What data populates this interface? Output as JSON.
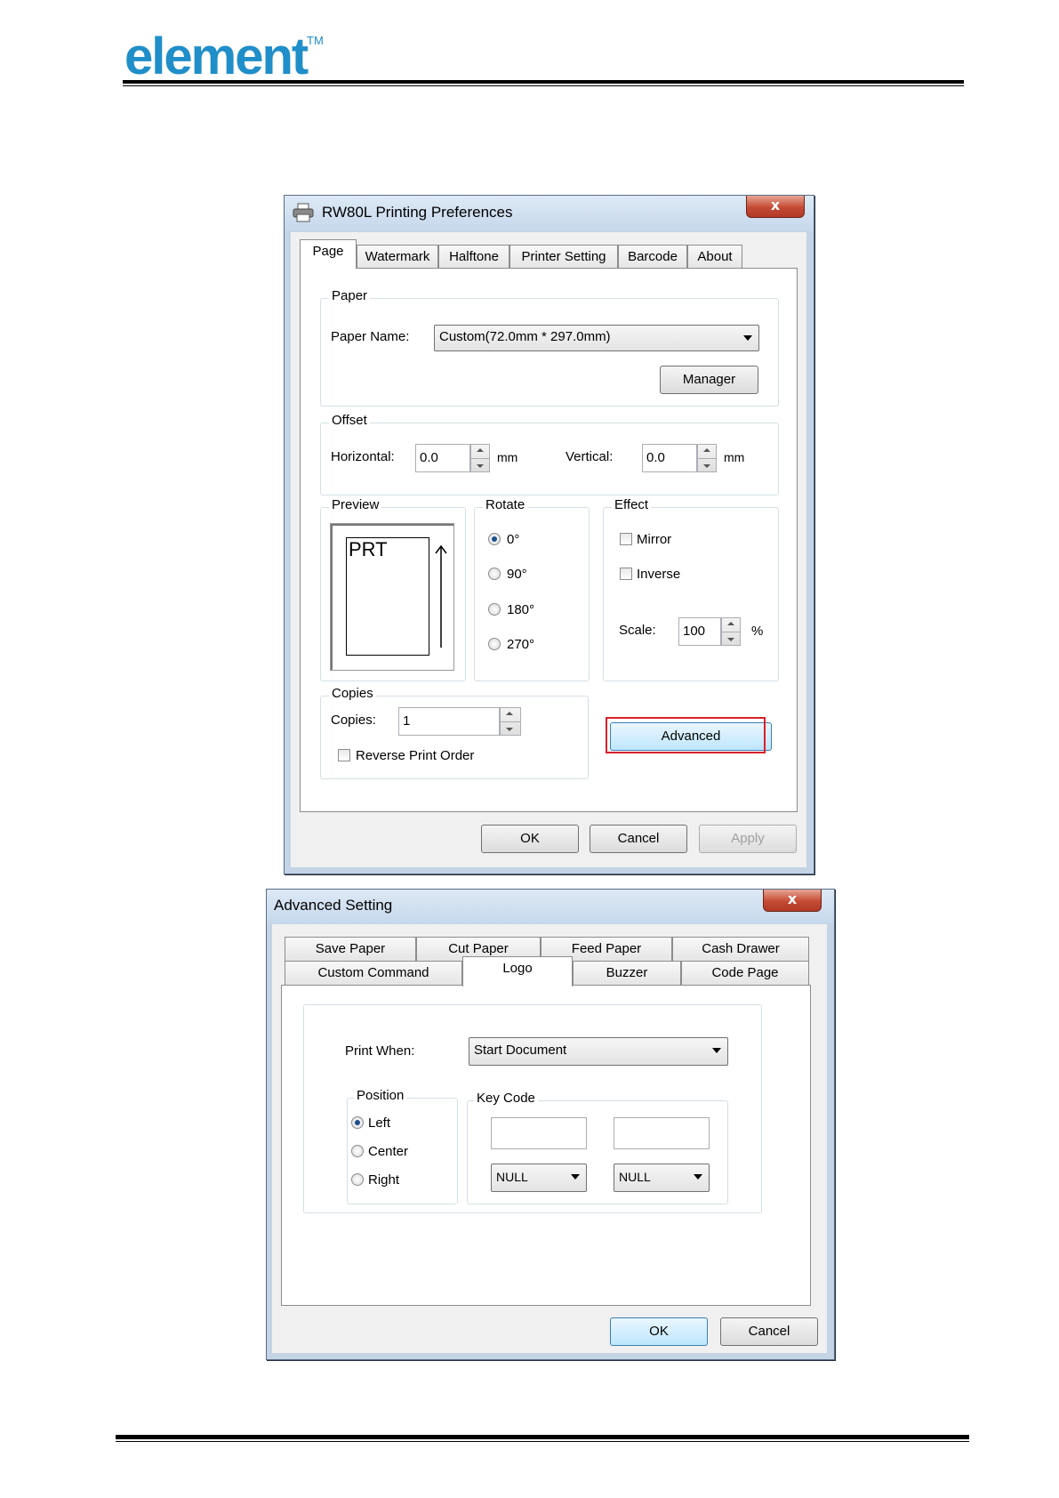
{
  "doc": {
    "logo_text": "element",
    "logo_tm": "TM"
  },
  "prefs": {
    "title": "RW80L Printing Preferences",
    "close_glyph": "x",
    "tabs": [
      "Page",
      "Watermark",
      "Halftone",
      "Printer Setting",
      "Barcode",
      "About"
    ],
    "paper": {
      "group_label": "Paper",
      "name_label": "Paper Name:",
      "name_value": "Custom(72.0mm * 297.0mm)",
      "manager_button": "Manager"
    },
    "offset": {
      "group_label": "Offset",
      "horizontal_label": "Horizontal:",
      "horizontal_value": "0.0",
      "horizontal_unit": "mm",
      "vertical_label": "Vertical:",
      "vertical_value": "0.0",
      "vertical_unit": "mm"
    },
    "preview": {
      "group_label": "Preview",
      "page_text": "PRT"
    },
    "rotate": {
      "group_label": "Rotate",
      "options": [
        "0°",
        "90°",
        "180°",
        "270°"
      ],
      "selected": "0°"
    },
    "effect": {
      "group_label": "Effect",
      "mirror_label": "Mirror",
      "inverse_label": "Inverse",
      "scale_label": "Scale:",
      "scale_value": "100",
      "scale_unit": "%"
    },
    "copies": {
      "group_label": "Copies",
      "copies_label": "Copies:",
      "copies_value": "1",
      "reverse_label": "Reverse Print Order"
    },
    "advanced_button": "Advanced",
    "ok_button": "OK",
    "cancel_button": "Cancel",
    "apply_button": "Apply"
  },
  "advanced": {
    "title": "Advanced Setting",
    "close_glyph": "x",
    "tabs_row1": [
      "Save Paper",
      "Cut Paper",
      "Feed Paper",
      "Cash Drawer"
    ],
    "tabs_row2": [
      "Custom Command",
      "Logo",
      "Buzzer",
      "Code Page"
    ],
    "active_tab": "Logo",
    "print_when_label": "Print When:",
    "print_when_value": "Start Document",
    "position": {
      "group_label": "Position",
      "options": [
        "Left",
        "Center",
        "Right"
      ],
      "selected": "Left"
    },
    "keycode": {
      "group_label": "Key Code",
      "key1_value": "",
      "key2_value": "",
      "select1_value": "NULL",
      "select2_value": "NULL"
    },
    "ok_button": "OK",
    "cancel_button": "Cancel"
  }
}
